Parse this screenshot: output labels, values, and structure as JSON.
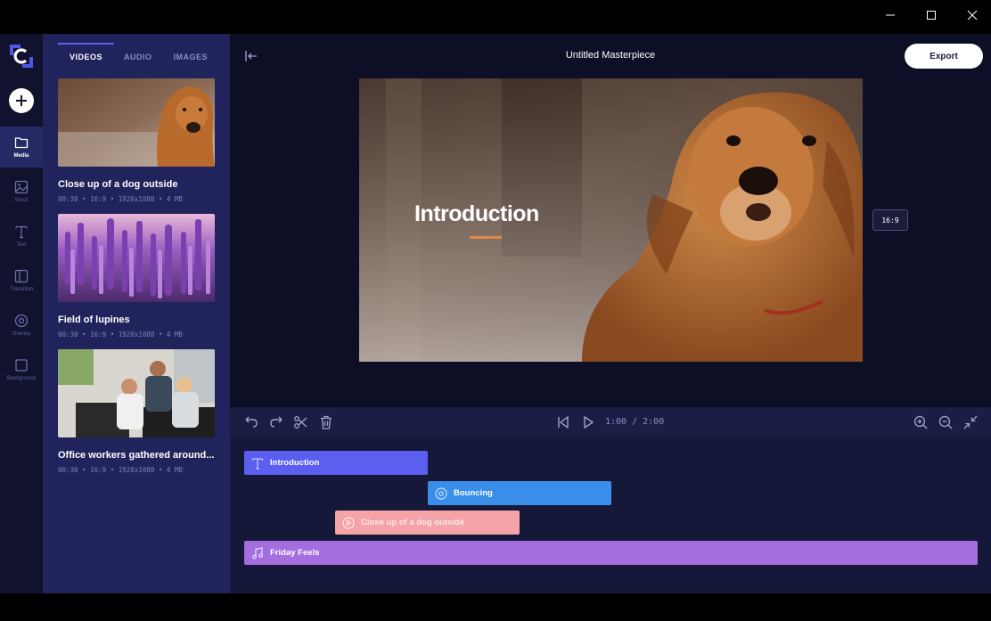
{
  "window": {
    "minimize_icon": "minimize-icon",
    "maximize_icon": "maximize-icon",
    "close_icon": "close-icon"
  },
  "colors": {
    "rail_bg": "#10122e",
    "panel_bg": "#21235c",
    "canvas_bg": "#0d0f26",
    "accent": "#5a62f0",
    "clip_text": "#5b5ff0",
    "clip_overlay": "#3a8de8",
    "clip_video": "#f4a3a6",
    "clip_audio": "#a46ee0"
  },
  "rail": {
    "items": [
      {
        "label": "Media",
        "icon": "folder-icon"
      },
      {
        "label": "Stock",
        "icon": "image-icon"
      },
      {
        "label": "Text",
        "icon": "text-icon"
      },
      {
        "label": "Transition",
        "icon": "transition-icon"
      },
      {
        "label": "Overlay",
        "icon": "overlay-icon"
      },
      {
        "label": "Background",
        "icon": "background-icon"
      }
    ]
  },
  "panel": {
    "tabs": [
      "VIDEOS",
      "AUDIO",
      "IMAGES"
    ],
    "active_tab": "VIDEOS",
    "media": [
      {
        "title": "Close up of a dog outside",
        "meta": "00:30 • 16:9 • 1920x1080 • 4 MB"
      },
      {
        "title": "Field of lupines",
        "meta": "00:30 • 16:9 • 1920x1080 • 4 MB"
      },
      {
        "title": "Office workers gathered around...",
        "meta": "00:30 • 16:9 • 1920x1080 • 4 MB"
      }
    ]
  },
  "header": {
    "title": "Untitled Masterpiece",
    "export_label": "Export"
  },
  "preview": {
    "overlay_text": "Introduction",
    "aspect": "16:9"
  },
  "timeline": {
    "time": "1:00 / 2:00",
    "clips": [
      {
        "label": "Introduction",
        "type": "text"
      },
      {
        "label": "Bouncing",
        "type": "overlay"
      },
      {
        "label": "Close up of a dog outside",
        "type": "video"
      },
      {
        "label": "Friday Feels",
        "type": "audio"
      }
    ]
  }
}
